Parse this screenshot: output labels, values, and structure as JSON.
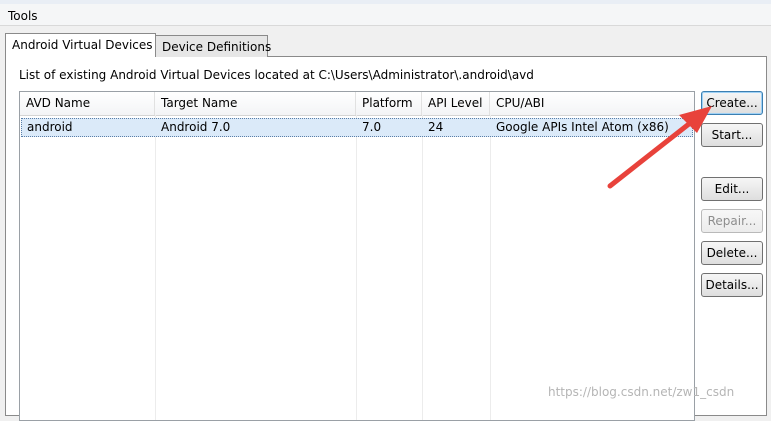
{
  "menubar": {
    "items": [
      "Tools"
    ]
  },
  "tabs": [
    {
      "label": "Android Virtual Devices",
      "active": true
    },
    {
      "label": "Device Definitions",
      "active": false
    }
  ],
  "avd_panel": {
    "path_label": "List of existing Android Virtual Devices located at C:\\Users\\Administrator\\.android\\avd",
    "columns": [
      "AVD Name",
      "Target Name",
      "Platform",
      "API Level",
      "CPU/ABI"
    ],
    "rows": [
      [
        "android",
        "Android 7.0",
        "7.0",
        "24",
        "Google APIs Intel Atom (x86)"
      ]
    ]
  },
  "buttons": {
    "create": "Create...",
    "start": "Start...",
    "edit": "Edit...",
    "repair": "Repair...",
    "delete": "Delete...",
    "details": "Details..."
  },
  "annotation": {
    "arrow_color": "#e8423b",
    "arrow_target": "create-button"
  },
  "watermark": "https://blog.csdn.net/zw1_csdn"
}
